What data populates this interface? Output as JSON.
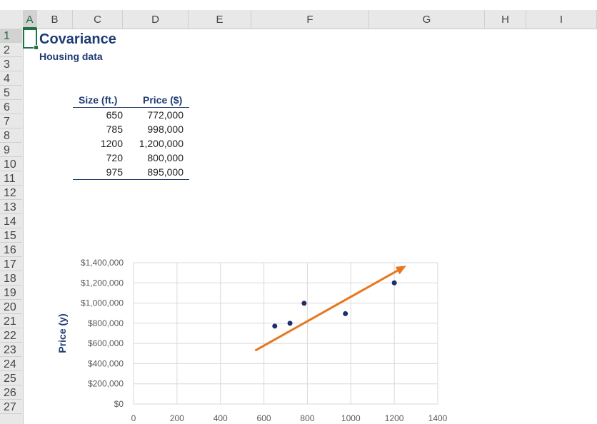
{
  "spreadsheet": {
    "columns": [
      "A",
      "B",
      "C",
      "D",
      "E",
      "F",
      "G",
      "H",
      "I"
    ],
    "rows": [
      "1",
      "2",
      "3",
      "4",
      "5",
      "6",
      "7",
      "8",
      "9",
      "10",
      "11",
      "12",
      "13",
      "14",
      "15",
      "16",
      "17",
      "18",
      "19",
      "20",
      "21",
      "22",
      "23",
      "24",
      "25",
      "26",
      "27"
    ],
    "selected_column": "A",
    "selected_row": "1"
  },
  "sheet": {
    "title": "Covariance",
    "subtitle": "Housing data"
  },
  "table": {
    "headers": [
      "Size (ft.)",
      "Price ($)"
    ],
    "rows": [
      [
        "650",
        "772,000"
      ],
      [
        "785",
        "998,000"
      ],
      [
        "1200",
        "1,200,000"
      ],
      [
        "720",
        "800,000"
      ],
      [
        "975",
        "895,000"
      ]
    ]
  },
  "chart_data": {
    "type": "scatter",
    "title": "",
    "xlabel": "",
    "ylabel": "Price (y)",
    "x": [
      650,
      785,
      1200,
      720,
      975
    ],
    "y": [
      772000,
      998000,
      1200000,
      800000,
      895000
    ],
    "xlim": [
      0,
      1400
    ],
    "ylim": [
      0,
      1400000
    ],
    "xticks": [
      "0",
      "200",
      "400",
      "600",
      "800",
      "1000",
      "1200",
      "1400"
    ],
    "yticks": [
      "$0",
      "$200,000",
      "$400,000",
      "$600,000",
      "$800,000",
      "$1,000,000",
      "$1,200,000",
      "$1,400,000"
    ],
    "grid": true,
    "legend": "none",
    "point_color": "#1f2d6b",
    "trend_arrow": {
      "x0": 560,
      "y0": 530000,
      "x1": 1255,
      "y1": 1370000,
      "color": "#e8761f"
    }
  }
}
